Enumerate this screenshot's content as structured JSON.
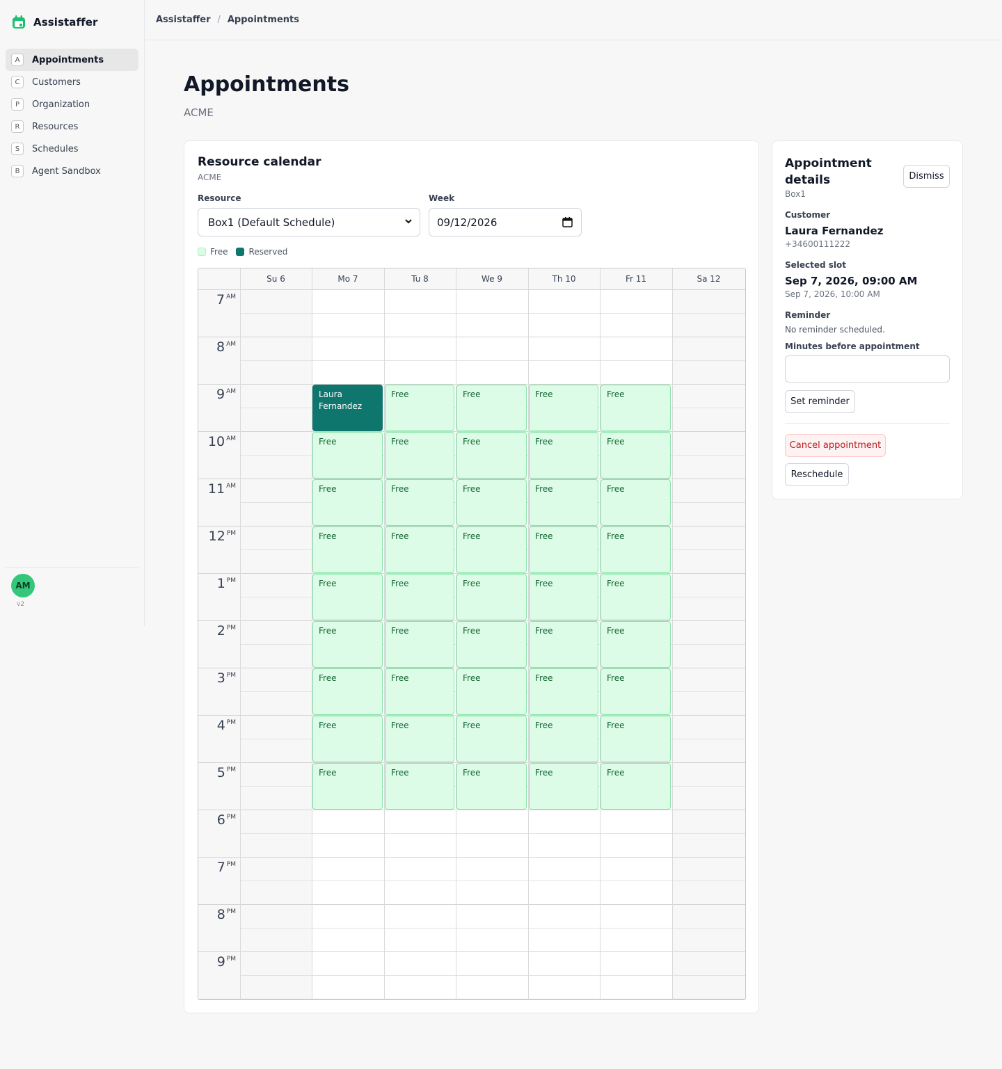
{
  "app": {
    "name": "Assistaffer",
    "version": "v2"
  },
  "sidebar": {
    "items": [
      {
        "key": "A",
        "label": "Appointments",
        "active": true
      },
      {
        "key": "C",
        "label": "Customers",
        "active": false
      },
      {
        "key": "P",
        "label": "Organization",
        "active": false
      },
      {
        "key": "R",
        "label": "Resources",
        "active": false
      },
      {
        "key": "S",
        "label": "Schedules",
        "active": false
      },
      {
        "key": "B",
        "label": "Agent Sandbox",
        "active": false
      }
    ],
    "user_initials": "AM"
  },
  "breadcrumb": {
    "root": "Assistaffer",
    "separator": "/",
    "current": "Appointments"
  },
  "page": {
    "title": "Appointments",
    "subtitle": "ACME"
  },
  "calendar": {
    "title": "Resource calendar",
    "subtitle": "ACME",
    "resource_label": "Resource",
    "resource_value": "Box1 (Default Schedule)",
    "week_label": "Week",
    "week_value": "09/12/2026",
    "legend": {
      "free": "Free",
      "reserved": "Reserved"
    },
    "days": [
      "Su 6",
      "Mo 7",
      "Tu 8",
      "We 9",
      "Th 10",
      "Fr 11",
      "Sa 12"
    ],
    "hours": [
      {
        "h": "7",
        "ap": "AM"
      },
      {
        "h": "8",
        "ap": "AM"
      },
      {
        "h": "9",
        "ap": "AM"
      },
      {
        "h": "10",
        "ap": "AM"
      },
      {
        "h": "11",
        "ap": "AM"
      },
      {
        "h": "12",
        "ap": "PM"
      },
      {
        "h": "1",
        "ap": "PM"
      },
      {
        "h": "2",
        "ap": "PM"
      },
      {
        "h": "3",
        "ap": "PM"
      },
      {
        "h": "4",
        "ap": "PM"
      },
      {
        "h": "5",
        "ap": "PM"
      },
      {
        "h": "6",
        "ap": "PM"
      },
      {
        "h": "7",
        "ap": "PM"
      },
      {
        "h": "8",
        "ap": "PM"
      },
      {
        "h": "9",
        "ap": "PM"
      }
    ],
    "slot_text_free": "Free",
    "reserved_slot": {
      "day": 1,
      "hour_index": 2,
      "label": "Laura Fernandez"
    },
    "free_slot_days": [
      1,
      2,
      3,
      4,
      5
    ],
    "free_slot_hour_indices": [
      2,
      3,
      4,
      5,
      6,
      7,
      8,
      9,
      10
    ],
    "colors": {
      "free_bg": "#dcfce7",
      "free_border": "#86e3a8",
      "reserved_bg": "#0f766e",
      "weekend_bg": "#f7f7f7"
    }
  },
  "details": {
    "title": "Appointment details",
    "resource": "Box1",
    "dismiss": "Dismiss",
    "customer_label": "Customer",
    "customer_name": "Laura Fernandez",
    "customer_phone": "+34600111222",
    "slot_label": "Selected slot",
    "slot_start": "Sep 7, 2026, 09:00 AM",
    "slot_end": "Sep 7, 2026, 10:00 AM",
    "reminder_label": "Reminder",
    "reminder_status": "No reminder scheduled.",
    "minutes_label": "Minutes before appointment",
    "minutes_value": "",
    "set_reminder": "Set reminder",
    "cancel": "Cancel appointment",
    "reschedule": "Reschedule"
  }
}
